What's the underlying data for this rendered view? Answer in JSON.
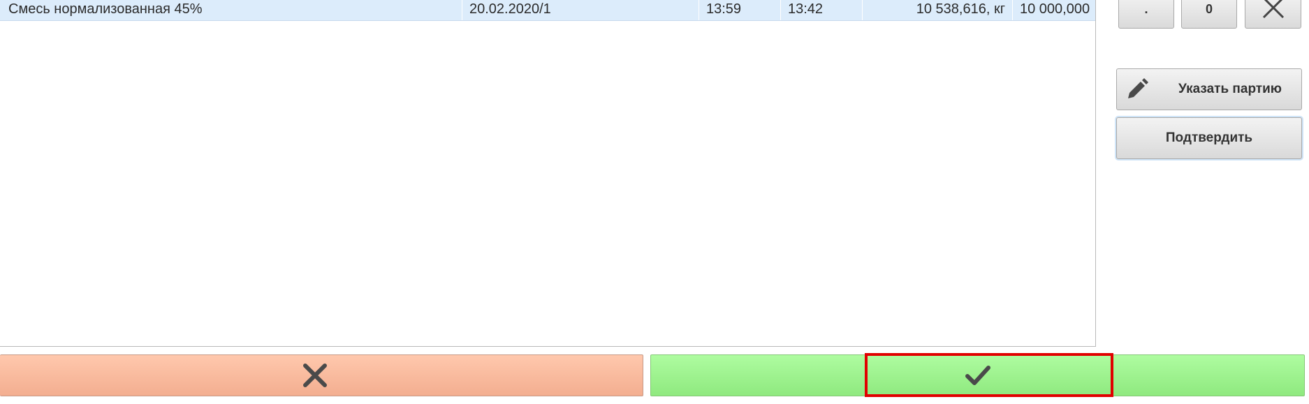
{
  "table": {
    "rows": [
      {
        "name": "Смесь нормализованная 45%",
        "batch": "20.02.2020/1",
        "time_start": "13:59",
        "time_end": "13:42",
        "weight": "10 538,616, кг",
        "amount": "10 000,000"
      }
    ]
  },
  "keypad": {
    "dot_label": ".",
    "zero_label": "0",
    "delete_icon": "close-icon"
  },
  "side_buttons": {
    "set_batch_label": "Указать партию",
    "set_batch_icon": "pencil-icon",
    "confirm_label": "Подтвердить"
  },
  "bottom_buttons": {
    "cancel_icon": "close-icon",
    "ok_icon": "checkmark-icon",
    "cancel_color": "#f7b89b",
    "ok_color": "#9cf48c",
    "highlight_color": "#e10000"
  }
}
